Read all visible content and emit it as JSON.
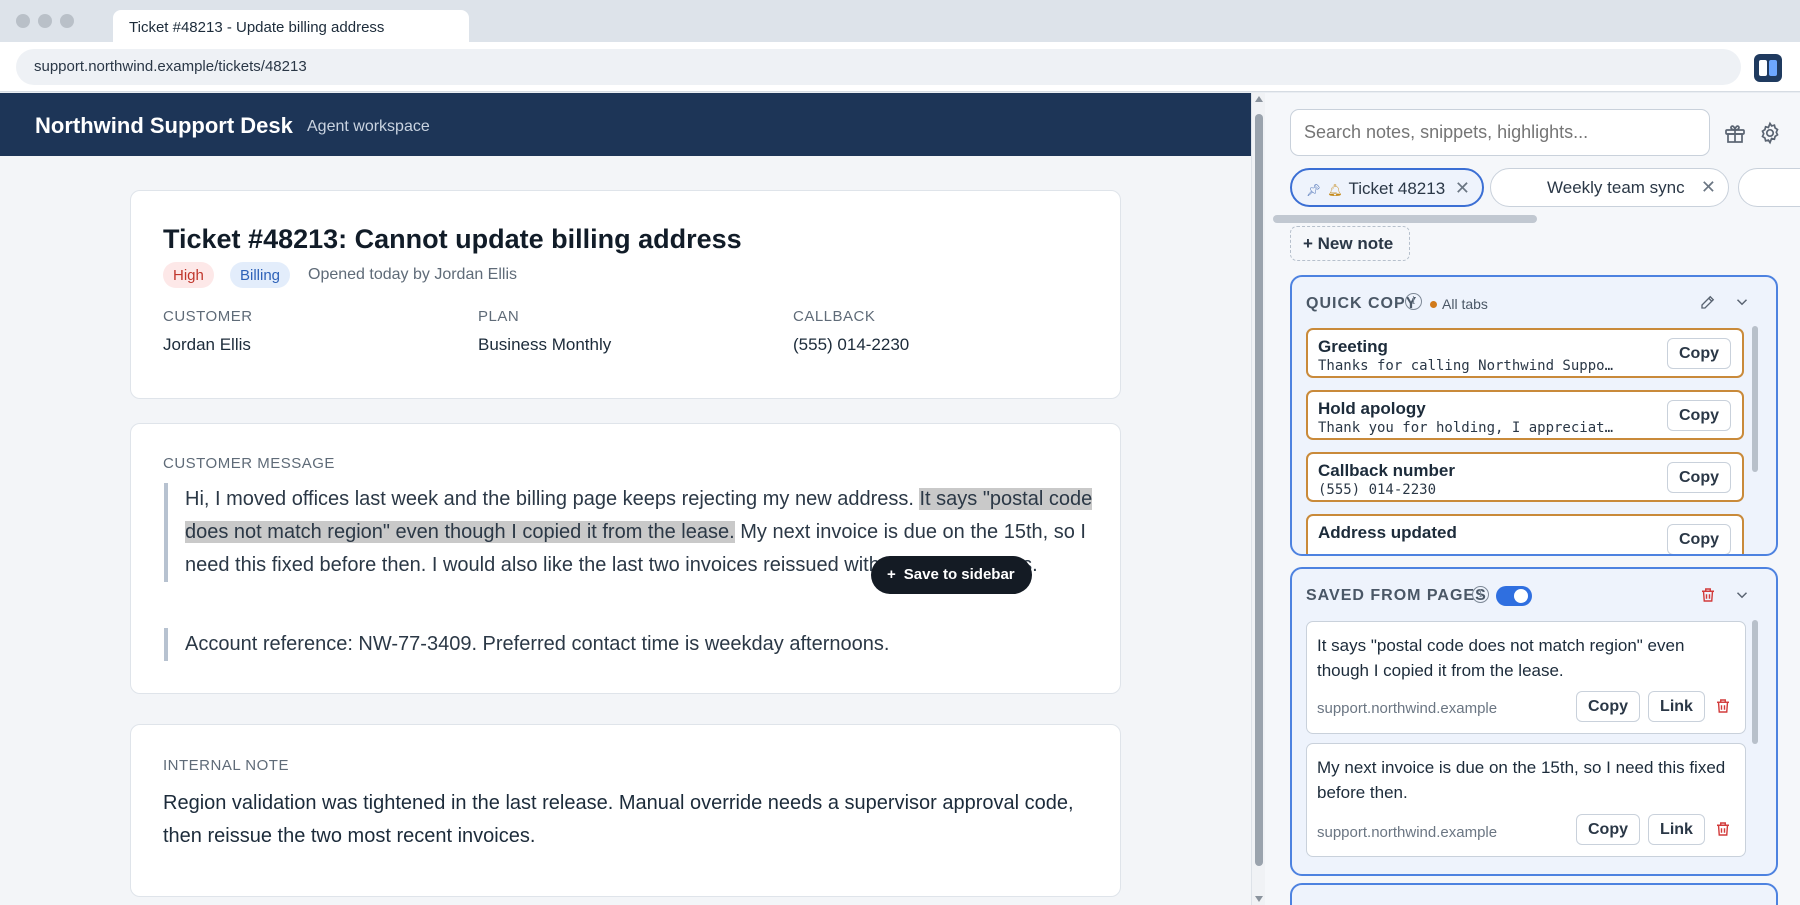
{
  "browser": {
    "tab_title": "Ticket #48213 - Update billing address",
    "url": "support.northwind.example/tickets/48213"
  },
  "app": {
    "title": "Northwind Support Desk",
    "subtitle": "Agent workspace"
  },
  "ticket": {
    "title": "Ticket #48213: Cannot update billing address",
    "priority": "High",
    "category": "Billing",
    "opened": "Opened today by Jordan Ellis",
    "meta": [
      {
        "label": "CUSTOMER",
        "value": "Jordan Ellis"
      },
      {
        "label": "PLAN",
        "value": "Business Monthly"
      },
      {
        "label": "CALLBACK",
        "value": "(555) 014-2230"
      }
    ]
  },
  "message": {
    "label": "CUSTOMER MESSAGE",
    "p1_before": "Hi, I moved offices last week and the billing page keeps rejecting my new address. ",
    "p1_highlight": "It says \"postal code does not match region\" even though I copied it from the lease.",
    "p1_after": " My next invoice is due on the 15th, so I need this fixed before then. I would also like the last two invoices reissued with the new address.",
    "p2": "Account reference: NW-77-3409. Preferred contact time is weekday afternoons.",
    "save_button": "Save to sidebar"
  },
  "internal_note": {
    "label": "INTERNAL NOTE",
    "text": "Region validation was tightened in the last release. Manual override needs a supervisor approval code, then reissue the two most recent invoices."
  },
  "sidebar": {
    "search_placeholder": "Search notes, snippets, highlights...",
    "tabs": [
      {
        "label": "Ticket 48213",
        "active": true,
        "pinned": true
      },
      {
        "label": "Weekly team sync",
        "active": false
      },
      {
        "label": "",
        "active": false
      }
    ],
    "new_note": "+ New note",
    "quick_copy": {
      "title": "QUICK COPY",
      "scope": "All tabs",
      "items": [
        {
          "name": "Greeting",
          "snippet": "Thanks for calling Northwind Support…",
          "button": "Copy"
        },
        {
          "name": "Hold apology",
          "snippet": "Thank you for holding, I appreciate …",
          "button": "Copy"
        },
        {
          "name": "Callback number",
          "snippet": "(555) 014-2230",
          "button": "Copy"
        },
        {
          "name": "Address updated",
          "snippet": "",
          "button": "Copy"
        }
      ]
    },
    "saved": {
      "title": "SAVED FROM PAGES",
      "enabled": true,
      "items": [
        {
          "text": "It says \"postal code does not match region\" even though I copied it from the lease.",
          "source": "support.northwind.example",
          "copy": "Copy",
          "link": "Link"
        },
        {
          "text": "My next invoice is due on the 15th, so I need this fixed before then.",
          "source": "support.northwind.example",
          "copy": "Copy",
          "link": "Link"
        }
      ]
    }
  },
  "colors": {
    "header": "#1d3557",
    "accent": "#4d82e0",
    "quick_copy_border": "#c98a3a",
    "danger": "#d23b3b"
  }
}
